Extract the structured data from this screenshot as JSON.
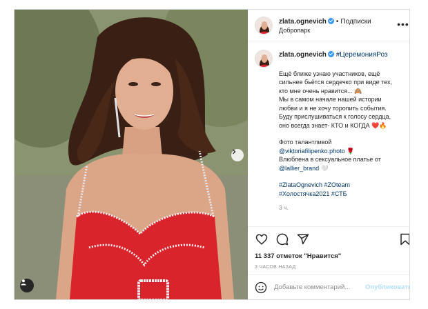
{
  "post": {
    "username": "zlata.ognevich",
    "follow_dot": "•",
    "follow_label": "Подписки",
    "location": "Добропарк",
    "more_label": "•••",
    "caption": {
      "username": "zlata.ognevich",
      "hashtag_main": "#ЦеремонияРоз",
      "lines": [
        "Ещё ближе узнаю участников, ещё",
        "сильнее бьётся сердечко при виде тех,",
        "кто мне очень нравится... 🙈",
        "Мы в самом начале нашей истории",
        "любви и я не хочу торопить события.",
        "Буду прислушиваться к голосу сердца,",
        "оно всегда знает- КТО и КОГДА ❤️🔥"
      ],
      "credit_prefix": "Фото талантливой",
      "credit_user": "@viktoriafilipenko.photo 🌹",
      "dress_line": "Влюблена в сексуальное платье от",
      "dress_user": "@lallier_brand 🤍",
      "tags_line1": "#ZlataOgnevich #ZOteam",
      "tags_line2": "#Холостячка2021 #СТБ",
      "ago": "3 ч."
    },
    "likes": "11 337 отметок \"Нравится\"",
    "time": "3 ЧАСОВ НАЗАД",
    "comment_placeholder": "Добавьте комментарий...",
    "publish_label": "Опубликовать"
  },
  "colors": {
    "dress": "#d8242a",
    "link": "#00376b",
    "verified": "#3897f0",
    "publish_disabled": "#b2dffc"
  },
  "icons": [
    "verified-badge-icon",
    "more-icon",
    "chevron-right-icon",
    "user-tag-icon",
    "heart-icon",
    "comment-icon",
    "share-icon",
    "bookmark-icon",
    "emoji-icon"
  ]
}
